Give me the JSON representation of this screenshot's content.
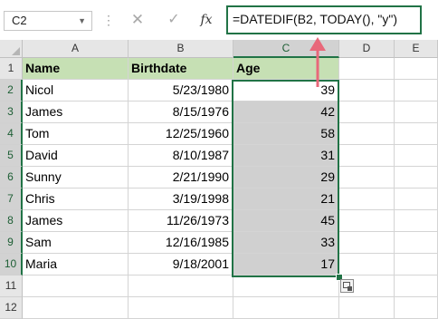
{
  "namebox": {
    "value": "C2"
  },
  "formula_bar": {
    "cancel_icon": "✕",
    "enter_icon": "✓",
    "fx_label": "fx",
    "formula": "=DATEDIF(B2, TODAY(), \"y\")"
  },
  "columns": [
    "A",
    "B",
    "C",
    "D",
    "E"
  ],
  "rows": [
    "1",
    "2",
    "3",
    "4",
    "5",
    "6",
    "7",
    "8",
    "9",
    "10",
    "11",
    "12"
  ],
  "header": {
    "name": "Name",
    "birthdate": "Birthdate",
    "age": "Age"
  },
  "data": [
    {
      "name": "Nicol",
      "birthdate": "5/23/1980",
      "age": "39"
    },
    {
      "name": "James",
      "birthdate": "8/15/1976",
      "age": "42"
    },
    {
      "name": "Tom",
      "birthdate": "12/25/1960",
      "age": "58"
    },
    {
      "name": "David",
      "birthdate": "8/10/1987",
      "age": "31"
    },
    {
      "name": "Sunny",
      "birthdate": "2/21/1990",
      "age": "29"
    },
    {
      "name": "Chris",
      "birthdate": "3/19/1998",
      "age": "21"
    },
    {
      "name": "James",
      "birthdate": "11/26/1973",
      "age": "45"
    },
    {
      "name": "Sam",
      "birthdate": "12/16/1985",
      "age": "33"
    },
    {
      "name": "Maria",
      "birthdate": "9/18/2001",
      "age": "17"
    }
  ],
  "colors": {
    "header_fill": "#c6e0b4",
    "selection_fill": "#d0d0d0",
    "selection_border": "#217346",
    "arrow": "#e8687a"
  }
}
